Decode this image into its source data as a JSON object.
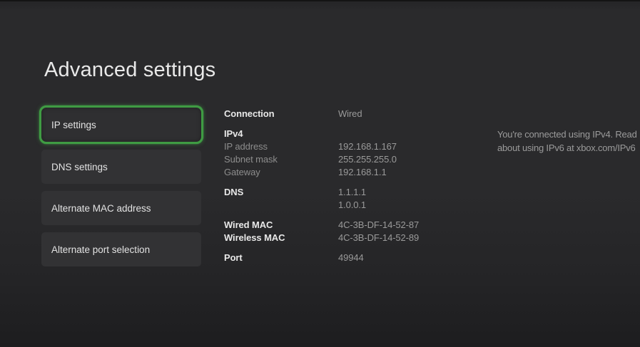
{
  "page": {
    "title": "Advanced settings"
  },
  "sidebar": {
    "items": [
      {
        "label": "IP settings",
        "selected": true
      },
      {
        "label": "DNS settings",
        "selected": false
      },
      {
        "label": "Alternate MAC address",
        "selected": false
      },
      {
        "label": "Alternate port selection",
        "selected": false
      }
    ]
  },
  "details": {
    "rows": [
      {
        "label": "Connection",
        "value": "Wired",
        "bold": true,
        "group_start": false
      },
      {
        "label": "IPv4",
        "value": "",
        "bold": true,
        "group_start": true
      },
      {
        "label": "IP address",
        "value": "192.168.1.167",
        "bold": false,
        "group_start": false
      },
      {
        "label": "Subnet mask",
        "value": "255.255.255.0",
        "bold": false,
        "group_start": false
      },
      {
        "label": "Gateway",
        "value": "192.168.1.1",
        "bold": false,
        "group_start": false
      },
      {
        "label": "DNS",
        "value": "1.1.1.1",
        "bold": true,
        "group_start": true
      },
      {
        "label": "",
        "value": "1.0.0.1",
        "bold": false,
        "group_start": false
      },
      {
        "label": "Wired MAC",
        "value": "4C-3B-DF-14-52-87",
        "bold": true,
        "group_start": true
      },
      {
        "label": "Wireless MAC",
        "value": "4C-3B-DF-14-52-89",
        "bold": true,
        "group_start": false
      },
      {
        "label": "Port",
        "value": "49944",
        "bold": true,
        "group_start": true
      }
    ]
  },
  "notice": {
    "line1": "You're connected using IPv4. Read",
    "line2": "about using IPv6 at xbox.com/IPv6"
  },
  "colors": {
    "accent_green": "#3f9b43",
    "background": "#2a2a2c",
    "tile_background": "#323234",
    "text_primary": "#e8e8e8",
    "text_secondary": "#9a9a9a"
  }
}
